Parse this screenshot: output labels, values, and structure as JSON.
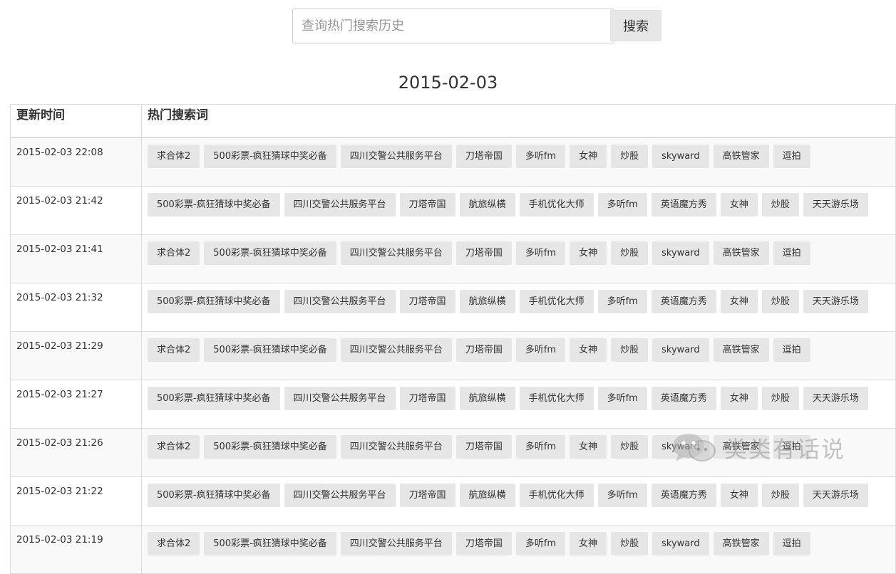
{
  "search": {
    "placeholder": "查询热门搜索历史",
    "value": "",
    "button_label": "搜索"
  },
  "date_title": "2015-02-03",
  "table": {
    "headers": [
      "更新时间",
      "热门搜索词"
    ],
    "rows": [
      {
        "time": "2015-02-03 22:08",
        "tags": [
          "求合体2",
          "500彩票-疯狂猜球中奖必备",
          "四川交警公共服务平台",
          "刀塔帝国",
          "多听fm",
          "女神",
          "炒股",
          "skyward",
          "高铁管家",
          "逗拍"
        ]
      },
      {
        "time": "2015-02-03 21:42",
        "tags": [
          "500彩票-疯狂猜球中奖必备",
          "四川交警公共服务平台",
          "刀塔帝国",
          "航旅纵横",
          "手机优化大师",
          "多听fm",
          "英语魔方秀",
          "女神",
          "炒股",
          "天天游乐场"
        ]
      },
      {
        "time": "2015-02-03 21:41",
        "tags": [
          "求合体2",
          "500彩票-疯狂猜球中奖必备",
          "四川交警公共服务平台",
          "刀塔帝国",
          "多听fm",
          "女神",
          "炒股",
          "skyward",
          "高铁管家",
          "逗拍"
        ]
      },
      {
        "time": "2015-02-03 21:32",
        "tags": [
          "500彩票-疯狂猜球中奖必备",
          "四川交警公共服务平台",
          "刀塔帝国",
          "航旅纵横",
          "手机优化大师",
          "多听fm",
          "英语魔方秀",
          "女神",
          "炒股",
          "天天游乐场"
        ]
      },
      {
        "time": "2015-02-03 21:29",
        "tags": [
          "求合体2",
          "500彩票-疯狂猜球中奖必备",
          "四川交警公共服务平台",
          "刀塔帝国",
          "多听fm",
          "女神",
          "炒股",
          "skyward",
          "高铁管家",
          "逗拍"
        ]
      },
      {
        "time": "2015-02-03 21:27",
        "tags": [
          "500彩票-疯狂猜球中奖必备",
          "四川交警公共服务平台",
          "刀塔帝国",
          "航旅纵横",
          "手机优化大师",
          "多听fm",
          "英语魔方秀",
          "女神",
          "炒股",
          "天天游乐场"
        ]
      },
      {
        "time": "2015-02-03 21:26",
        "tags": [
          "求合体2",
          "500彩票-疯狂猜球中奖必备",
          "四川交警公共服务平台",
          "刀塔帝国",
          "多听fm",
          "女神",
          "炒股",
          "skyward",
          "高铁管家",
          "逗拍"
        ]
      },
      {
        "time": "2015-02-03 21:22",
        "tags": [
          "500彩票-疯狂猜球中奖必备",
          "四川交警公共服务平台",
          "刀塔帝国",
          "航旅纵横",
          "手机优化大师",
          "多听fm",
          "英语魔方秀",
          "女神",
          "炒股",
          "天天游乐场"
        ]
      },
      {
        "time": "2015-02-03 21:19",
        "tags": [
          "求合体2",
          "500彩票-疯狂猜球中奖必备",
          "四川交警公共服务平台",
          "刀塔帝国",
          "多听fm",
          "女神",
          "炒股",
          "skyward",
          "高铁管家",
          "逗拍"
        ]
      }
    ]
  },
  "watermark": {
    "icon": "wechat-logo-icon",
    "text": "类类有话说"
  }
}
